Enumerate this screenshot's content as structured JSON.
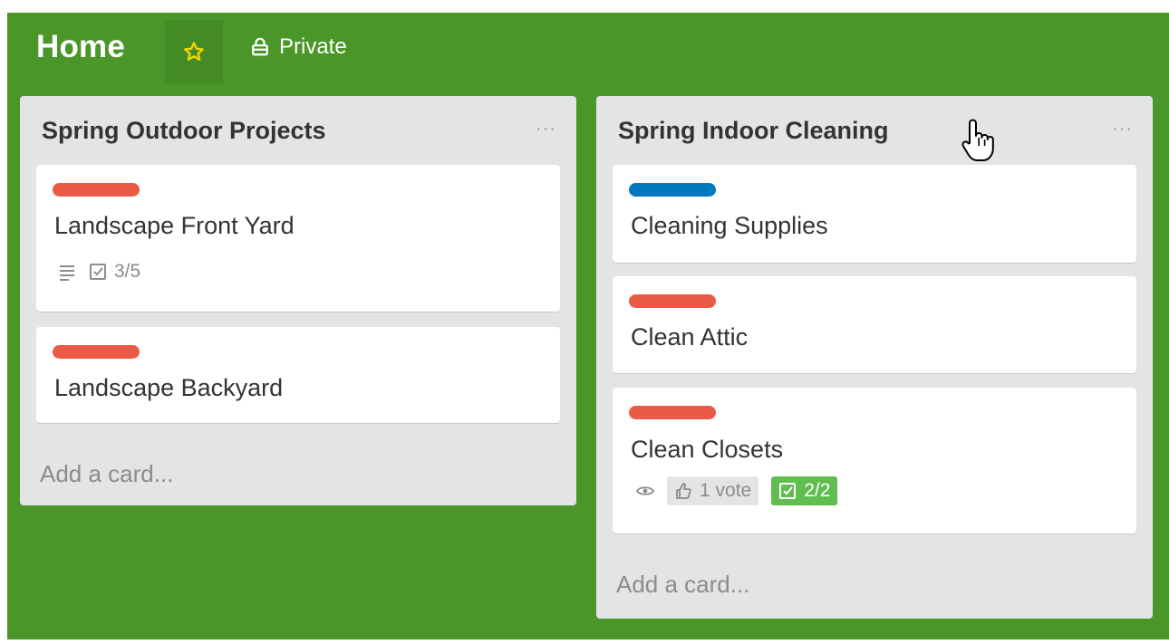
{
  "board": {
    "title": "Home",
    "visibility": "Private",
    "colors": {
      "background": "#4a9629",
      "star": "#f2d600",
      "label_red": "#eb5a46",
      "label_blue": "#0079bf",
      "complete_green": "#61bd4f"
    }
  },
  "lists": [
    {
      "title": "Spring Outdoor Projects",
      "menu_glyph": "···",
      "cards": [
        {
          "label_color": "#eb5a46",
          "title": "Landscape Front Yard",
          "badges": {
            "description_icon": "description-icon",
            "checklist": "3/5"
          }
        },
        {
          "label_color": "#eb5a46",
          "title": "Landscape Backyard"
        }
      ],
      "add_card": "Add a card..."
    },
    {
      "title": "Spring Indoor Cleaning",
      "menu_glyph": "···",
      "cards": [
        {
          "label_color": "#0079bf",
          "title": "Cleaning Supplies"
        },
        {
          "label_color": "#eb5a46",
          "title": "Clean Attic"
        },
        {
          "label_color": "#eb5a46",
          "title": "Clean Closets",
          "badges": {
            "watch_icon": "eye-icon",
            "votes": "1 vote",
            "checklist": "2/2"
          }
        }
      ],
      "add_card": "Add a card..."
    }
  ],
  "cursor": "hand-pointer-icon"
}
